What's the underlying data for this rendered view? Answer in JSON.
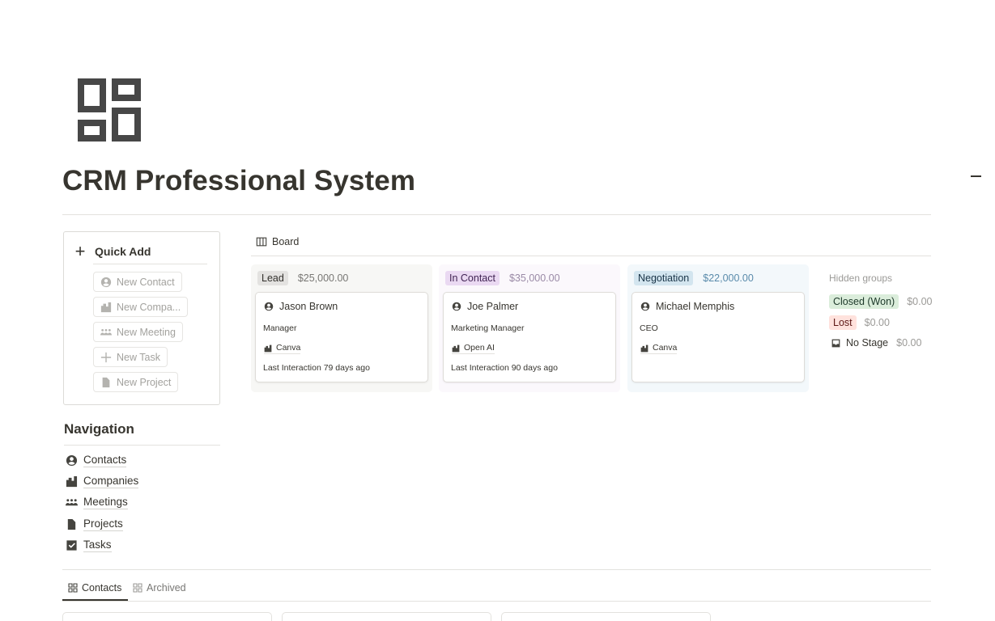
{
  "page": {
    "title": "CRM Professional System",
    "icon": "dashboard-layout-icon"
  },
  "quick_add": {
    "title": "Quick Add",
    "buttons": [
      {
        "label": "New Contact",
        "icon": "person-circle-icon"
      },
      {
        "label": "New Compa...",
        "icon": "buildings-icon"
      },
      {
        "label": "New Meeting",
        "icon": "people-group-icon"
      },
      {
        "label": "New Task",
        "icon": "plus-icon"
      },
      {
        "label": "New Project",
        "icon": "document-icon"
      }
    ]
  },
  "navigation": {
    "title": "Navigation",
    "items": [
      {
        "label": "Contacts",
        "icon": "person-circle-icon"
      },
      {
        "label": "Companies",
        "icon": "buildings-icon"
      },
      {
        "label": "Meetings",
        "icon": "people-group-icon"
      },
      {
        "label": "Projects",
        "icon": "document-icon"
      },
      {
        "label": "Tasks",
        "icon": "checkbox-icon"
      }
    ]
  },
  "board": {
    "view_label": "Board",
    "columns": [
      {
        "stage": "Lead",
        "total": "$25,000.00",
        "tag_bg": "#e3e2e0",
        "col_bg": "#f7f7f5",
        "total_color": "#787774",
        "card": {
          "name": "Jason Brown",
          "role": "Manager",
          "company": "Canva",
          "last_interaction": "Last Interaction 79 days ago"
        }
      },
      {
        "stage": "In Contact",
        "total": "$35,000.00",
        "tag_bg": "#ead9f2",
        "col_bg": "#fbf8fc",
        "total_color": "#9a8aa6",
        "card": {
          "name": "Joe Palmer",
          "role": "Marketing Manager",
          "company": "Open AI",
          "last_interaction": "Last Interaction 90 days ago"
        }
      },
      {
        "stage": "Negotiation",
        "total": "$22,000.00",
        "tag_bg": "#d3e5ef",
        "col_bg": "#f3f8fb",
        "total_color": "#5a8bab",
        "card": {
          "name": "Michael Memphis",
          "role": "CEO",
          "company": "Canva",
          "last_interaction": ""
        }
      }
    ],
    "hidden_groups": {
      "title": "Hidden groups",
      "groups": [
        {
          "stage": "Closed (Won)",
          "total": "$0.00",
          "tag_bg": "#dbeddb"
        },
        {
          "stage": "Lost",
          "total": "$0.00",
          "tag_bg": "#ffe2dd"
        },
        {
          "stage": "No Stage",
          "total": "$0.00",
          "icon": "inbox-icon"
        }
      ]
    }
  },
  "bottom_tabs": [
    {
      "label": "Contacts",
      "active": true
    },
    {
      "label": "Archived",
      "active": false
    }
  ]
}
